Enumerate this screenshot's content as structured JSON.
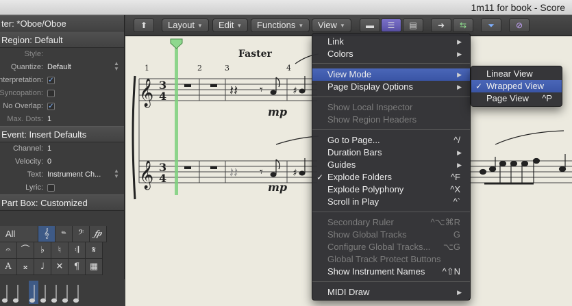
{
  "window": {
    "title": "1m11 for book - Score"
  },
  "inspector": {
    "filter_header": "ter: *Oboe/Oboe",
    "region_header": "Region:  Default",
    "region_params": [
      {
        "label": "Style:",
        "value": "",
        "dim": true
      },
      {
        "label": "Quantize:",
        "value": "Default"
      },
      {
        "label": "nterpretation:",
        "checked": true
      },
      {
        "label": "Syncopation:",
        "checked": false,
        "dim": true
      },
      {
        "label": "No Overlap:",
        "checked": true
      },
      {
        "label": "Max. Dots:",
        "value": "1"
      }
    ],
    "event_header": "Event:  Insert Defaults",
    "event_params": [
      {
        "label": "Channel:",
        "value": "1"
      },
      {
        "label": "Velocity:",
        "value": "0"
      },
      {
        "label": "Text:",
        "value": "Instrument Ch..."
      },
      {
        "label": "Lyric:",
        "checked": false
      }
    ],
    "partbox_header": "Part Box:  Customized",
    "partbox": {
      "all_label": "All",
      "row1": [
        "𝄞",
        "𝆮",
        "𝄢",
        "𝆑𝆏"
      ],
      "row2": [
        "𝄐",
        "⌒",
        "♭",
        "♮",
        "𝄇",
        "𝄋"
      ],
      "row3": [
        "A",
        "𝄪",
        "♩",
        "✕",
        "¶",
        "▦"
      ]
    }
  },
  "toolbar": {
    "layout_label": "Layout",
    "edit_label": "Edit",
    "functions_label": "Functions",
    "view_label": "View"
  },
  "score": {
    "tempo_text": "Faster",
    "dynamic_1": "mp",
    "dynamic_2": "mp",
    "bar_numbers": [
      "1",
      "2",
      "3",
      "4"
    ],
    "time_sig_top": "3",
    "time_sig_bottom": "4"
  },
  "view_menu": {
    "items": [
      {
        "label": "Link",
        "submenu": true
      },
      {
        "label": "Colors",
        "submenu": true
      },
      {
        "label": "View Mode",
        "submenu": true,
        "highlighted": true
      },
      {
        "label": "Page Display Options",
        "submenu": true
      },
      {
        "label": "Show Local Inspector",
        "disabled": true
      },
      {
        "label": "Show Region Headers",
        "disabled": true
      },
      {
        "label": "Go to Page...",
        "shortcut": "^/"
      },
      {
        "label": "Duration Bars",
        "submenu": true
      },
      {
        "label": "Guides",
        "submenu": true
      },
      {
        "label": "Explode Folders",
        "checked": true,
        "shortcut": "^F"
      },
      {
        "label": "Explode Polyphony",
        "shortcut": "^X"
      },
      {
        "label": "Scroll in Play",
        "shortcut": "^`"
      },
      {
        "label": "Secondary Ruler",
        "disabled": true,
        "shortcut": "^⌥⌘R"
      },
      {
        "label": "Show Global Tracks",
        "disabled": true,
        "shortcut": "G"
      },
      {
        "label": "Configure Global Tracks...",
        "disabled": true,
        "shortcut": "⌥G"
      },
      {
        "label": "Global Track Protect Buttons",
        "disabled": true
      },
      {
        "label": "Show Instrument Names",
        "shortcut": "^⇧N"
      },
      {
        "label": "MIDI Draw",
        "submenu": true
      }
    ]
  },
  "view_mode_submenu": {
    "items": [
      {
        "label": "Linear View"
      },
      {
        "label": "Wrapped View",
        "checked": true,
        "highlighted": true
      },
      {
        "label": "Page View",
        "shortcut": "^P"
      }
    ]
  },
  "colors": {
    "menu_highlight": "#3f5cae",
    "playhead": "#7cd07c",
    "score_paper": "#eceadf",
    "active_tool": "#6a62b8"
  }
}
